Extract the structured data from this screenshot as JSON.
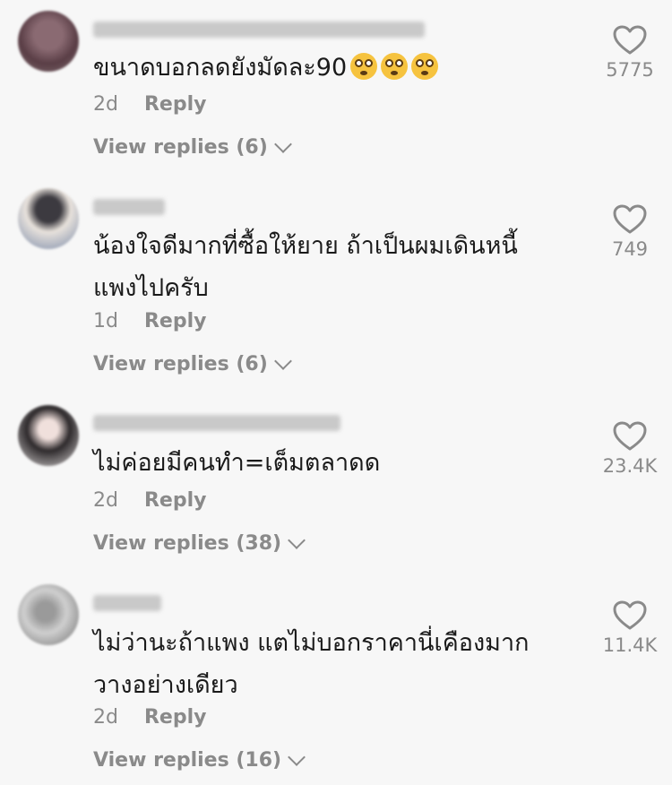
{
  "comments": [
    {
      "text_lines": [
        "ขนาดบอกลดยังมัดละ90"
      ],
      "emoji_icons": [
        "flushed-face-icon",
        "flushed-face-icon",
        "flushed-face-icon"
      ],
      "age": "2d",
      "reply_label": "Reply",
      "view_replies": "View replies (6)",
      "likes": "5775"
    },
    {
      "text_lines": [
        "น้องใจดีมากที่ซื้อให้ยาย ถ้าเป็นผมเดินหนี้",
        "แพงไปครับ"
      ],
      "emoji_icons": [],
      "age": "1d",
      "reply_label": "Reply",
      "view_replies": "View replies (6)",
      "likes": "749"
    },
    {
      "text_lines": [
        "ไม่ค่อยมีคนทำ=เต็มตลาดด"
      ],
      "emoji_icons": [],
      "age": "2d",
      "reply_label": "Reply",
      "view_replies": "View replies (38)",
      "likes": "23.4K"
    },
    {
      "text_lines": [
        "ไม่ว่านะถ้าแพง แตไม่บอกราคานี่เคืองมาก",
        "วางอย่างเดียว"
      ],
      "emoji_icons": [],
      "age": "2d",
      "reply_label": "Reply",
      "view_replies": "View replies (16)",
      "likes": "11.4K"
    }
  ],
  "colors": {
    "background": "#f7f7f7",
    "text": "#1a1a1a",
    "muted": "#8a8a8a"
  }
}
